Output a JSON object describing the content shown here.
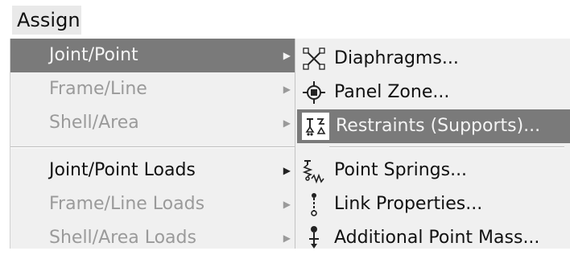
{
  "menubar": {
    "assign_label": "Assign"
  },
  "main_menu": {
    "items": [
      {
        "label": "Joint/Point",
        "state": "highlighted"
      },
      {
        "label": "Frame/Line",
        "state": "disabled"
      },
      {
        "label": "Shell/Area",
        "state": "disabled"
      },
      {
        "label": "Joint/Point Loads",
        "state": "enabled"
      },
      {
        "label": "Frame/Line Loads",
        "state": "disabled"
      },
      {
        "label": "Shell/Area Loads",
        "state": "disabled"
      }
    ]
  },
  "sub_menu": {
    "items": [
      {
        "label": "Diaphragms...",
        "icon": "diaphragm-icon",
        "state": "enabled"
      },
      {
        "label": "Panel Zone...",
        "icon": "panel-zone-icon",
        "state": "enabled"
      },
      {
        "label": "Restraints (Supports)...",
        "icon": "restraints-icon",
        "state": "highlighted"
      },
      {
        "label": "Point Springs...",
        "icon": "spring-icon",
        "state": "enabled"
      },
      {
        "label": "Link Properties...",
        "icon": "link-icon",
        "state": "enabled"
      },
      {
        "label": "Additional Point Mass...",
        "icon": "point-mass-icon",
        "state": "enabled"
      }
    ]
  },
  "submenu_arrow": "▶",
  "colors": {
    "highlight": "#7a7a7a",
    "menu_bg": "#f0f0f0",
    "disabled_text": "#9a9a9a"
  }
}
